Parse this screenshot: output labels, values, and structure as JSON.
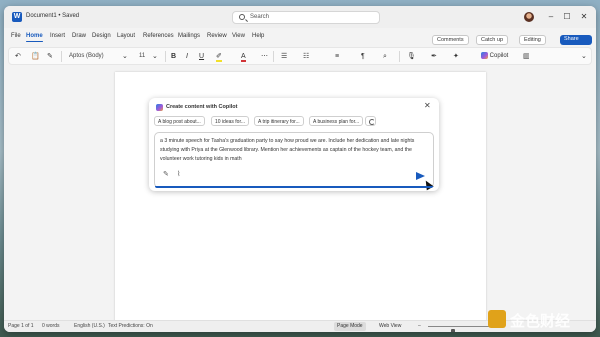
{
  "titlebar": {
    "doc_title": "Document1 • Saved",
    "search_placeholder": "Search"
  },
  "menu": {
    "items": [
      "File",
      "Home",
      "Insert",
      "Draw",
      "Design",
      "Layout",
      "References",
      "Mailings",
      "Review",
      "View",
      "Help"
    ],
    "active": "Home",
    "right_buttons": {
      "comments": "Comments",
      "catchup": "Catch up",
      "editing": "Editing",
      "share": "Share"
    }
  },
  "ribbon": {
    "font_name": "Aptos (Body)",
    "font_size": "11",
    "copilot_label": "Copilot"
  },
  "copilot_panel": {
    "title": "Create content with Copilot",
    "suggestions": [
      "A blog post about...",
      "10 ideas for...",
      "A trip itinerary for...",
      "A business plan for..."
    ],
    "prompt": "a 3 minute speech for Tasha's graduation party to say how proud we are. Include her dedication and late nights studying with Priya at the Glenwood library. Mention her achievements as captain of the hockey team, and the volunteer work tutoring kids in math"
  },
  "statusbar": {
    "page": "Page 1 of 1",
    "words": "0 words",
    "language": "English (U.S.)",
    "predictions": "Text Predictions: On",
    "page_mode": "Page Mode",
    "web_view": "Web View",
    "zoom_level": 0.35
  },
  "colors": {
    "accent": "#185abd",
    "highlight": "#f2e02a",
    "font_color": "#d13438"
  },
  "watermark": {
    "text": "金色财经"
  }
}
